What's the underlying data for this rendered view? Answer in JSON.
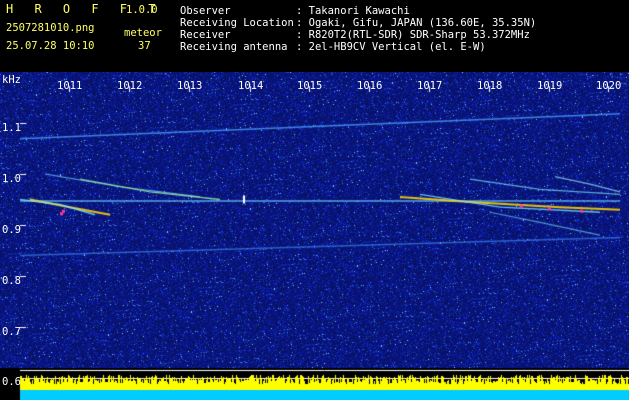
{
  "header": {
    "app_name": "H R O F F T",
    "version": "1.0.0",
    "filename": "2507281010.png",
    "datetime": "25.07.28 10:10",
    "meteor_label": "meteor",
    "meteor_count": "37",
    "info": [
      {
        "label": "Observer",
        "value": ": Takanori Kawachi"
      },
      {
        "label": "Receiving Location",
        "value": ": Ogaki, Gifu, JAPAN (136.60E, 35.35N)"
      },
      {
        "label": "Receiver",
        "value": ": R820T2(RTL-SDR) SDR-Sharp 53.372MHz"
      },
      {
        "label": "Receiving antenna",
        "value": ": 2el-HB9CV Vertical (el. E-W)"
      }
    ]
  },
  "spectrogram": {
    "y_unit": "kHz",
    "time_ticks": [
      "1011",
      "1012",
      "1013",
      "1014",
      "1015",
      "1016",
      "1017",
      "1018",
      "1019",
      "1020"
    ],
    "freq_ticks": [
      "1.1",
      "1.0",
      "0.9",
      "0.8",
      "0.7",
      "0.6"
    ],
    "colors": {
      "background": "#0a1466",
      "trace_hot": "#ffd400",
      "trace_cool": "#7fe8ff",
      "grid": "#ffffff",
      "level_yellow": "#ffff00",
      "level_cyan": "#00ccff"
    }
  }
}
